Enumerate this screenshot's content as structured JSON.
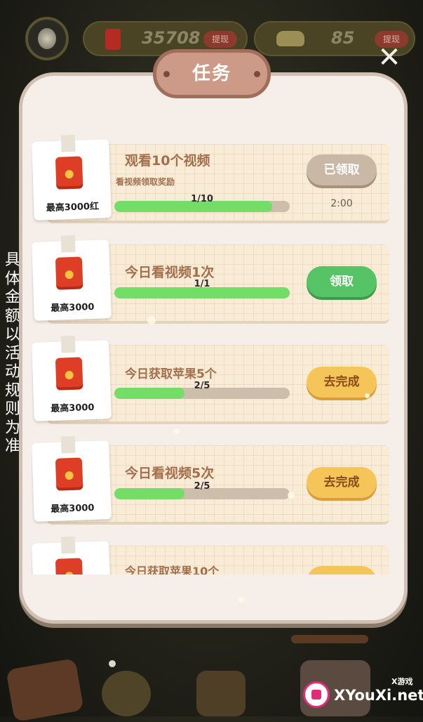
{
  "header": {
    "red_packet_balance": "35708",
    "red_packet_withdraw_label": "提现",
    "gold_balance": "85",
    "gold_withdraw_label": "提现"
  },
  "panel": {
    "title": "任务"
  },
  "tasks": [
    {
      "reward_label": "最高3000红",
      "title": "观看10个视频",
      "subtitle": "看视频领取奖励",
      "progress_text": "1/10",
      "progress_fraction": 0.9,
      "button_label": "已领取",
      "button_state": "claimed",
      "cooldown": "2:00"
    },
    {
      "reward_label": "最高3000",
      "title": "今日看视频1次",
      "subtitle": "",
      "progress_text": "1/1",
      "progress_fraction": 1.0,
      "button_label": "领取",
      "button_state": "claim",
      "cooldown": ""
    },
    {
      "reward_label": "最高3000",
      "title": "今日获取苹果5个",
      "subtitle": "",
      "progress_text": "2/5",
      "progress_fraction": 0.4,
      "button_label": "去完成",
      "button_state": "go",
      "cooldown": ""
    },
    {
      "reward_label": "最高3000",
      "title": "今日看视频5次",
      "subtitle": "",
      "progress_text": "2/5",
      "progress_fraction": 0.4,
      "button_label": "去完成",
      "button_state": "go",
      "cooldown": ""
    },
    {
      "reward_label": "",
      "title": "今日获取苹果10个",
      "subtitle": "",
      "progress_text": "",
      "progress_fraction": 0,
      "button_label": "",
      "button_state": "go",
      "cooldown": ""
    }
  ],
  "side_note": "具体金额以活动规则为准",
  "watermark": {
    "site": "XYouXi.net",
    "brand_small": "X游戏"
  },
  "colors": {
    "panel_bg": "#f6efe9",
    "title_plate": "#cc9a86",
    "progress_fill": "#74dd68",
    "claim_green": "#56c466",
    "go_yellow": "#f5c55a",
    "claimed_gray": "#c9b8a5",
    "envelope_red": "#de3e26"
  },
  "icons": [
    "avatar",
    "red-envelope-icon",
    "gold-ingot-icon",
    "close-icon"
  ]
}
